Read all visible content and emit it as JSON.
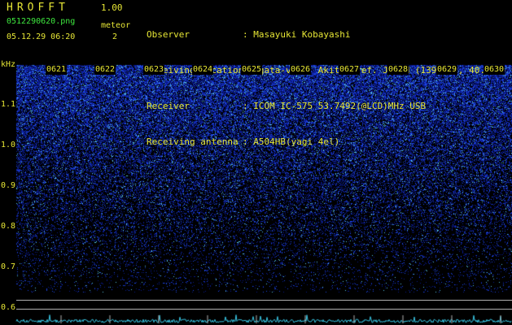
{
  "app": {
    "title": "HROFFT",
    "version": "1.00"
  },
  "file": {
    "name": "0512290620.png",
    "datetime": "05.12.29 06:20"
  },
  "meteor": {
    "label": "meteor",
    "count": "2"
  },
  "station": [
    {
      "label": "Observer",
      "value": ": Masayuki Kobayashi"
    },
    {
      "label": "Receiving Location",
      "value": ": Ogata-vill. Akita-Pref. JAPAN (139.96E, 40.02N)"
    },
    {
      "label": "Receiver",
      "value": ": ICOM IC-575 53.7492(@LCD)MHz USB"
    },
    {
      "label": "Receiving antenna",
      "value": ": A504HB(yagi 4el)"
    }
  ],
  "axis": {
    "freq_unit": "kHz",
    "freq_labels": [
      "1.1",
      "1.0",
      "0.9",
      "0.8",
      "0.7",
      "0.6"
    ],
    "time_labels": [
      "0621",
      "0622",
      "0623",
      "0624",
      "0625",
      "0626",
      "0627",
      "0628",
      "0629",
      "0630"
    ]
  },
  "colors": {
    "text": "#e6e635",
    "background": "#000000",
    "noise_low": "#0a1a8a",
    "noise_high": "#3aa0ff",
    "level_trace": "#39c8e6"
  }
}
